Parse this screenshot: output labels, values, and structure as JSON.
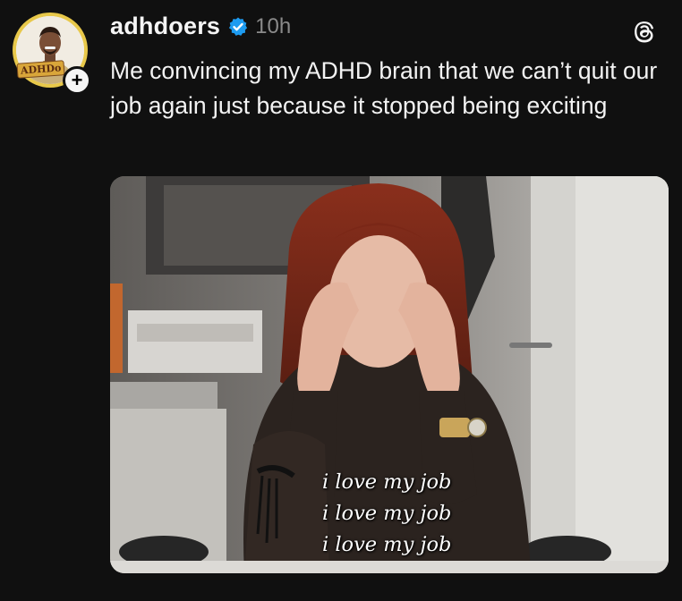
{
  "post": {
    "username": "adhdoers",
    "timestamp": "10h",
    "caption": "Me convincing my ADHD brain that we can’t quit our job again just because it stopped being exciting",
    "avatar_badge": "ADHDo",
    "follow_symbol": "+",
    "media": {
      "overlay_lines": [
        "i love my job",
        "i love my job",
        "i love my job"
      ]
    }
  },
  "colors": {
    "background": "#101010",
    "verified": "#1d9bf0",
    "timestamp": "#8a8a8a",
    "avatar_ring": "#e8c84a"
  },
  "icons": {
    "verified": "verified-badge-icon",
    "threads": "threads-logo-icon",
    "follow": "plus-icon"
  }
}
